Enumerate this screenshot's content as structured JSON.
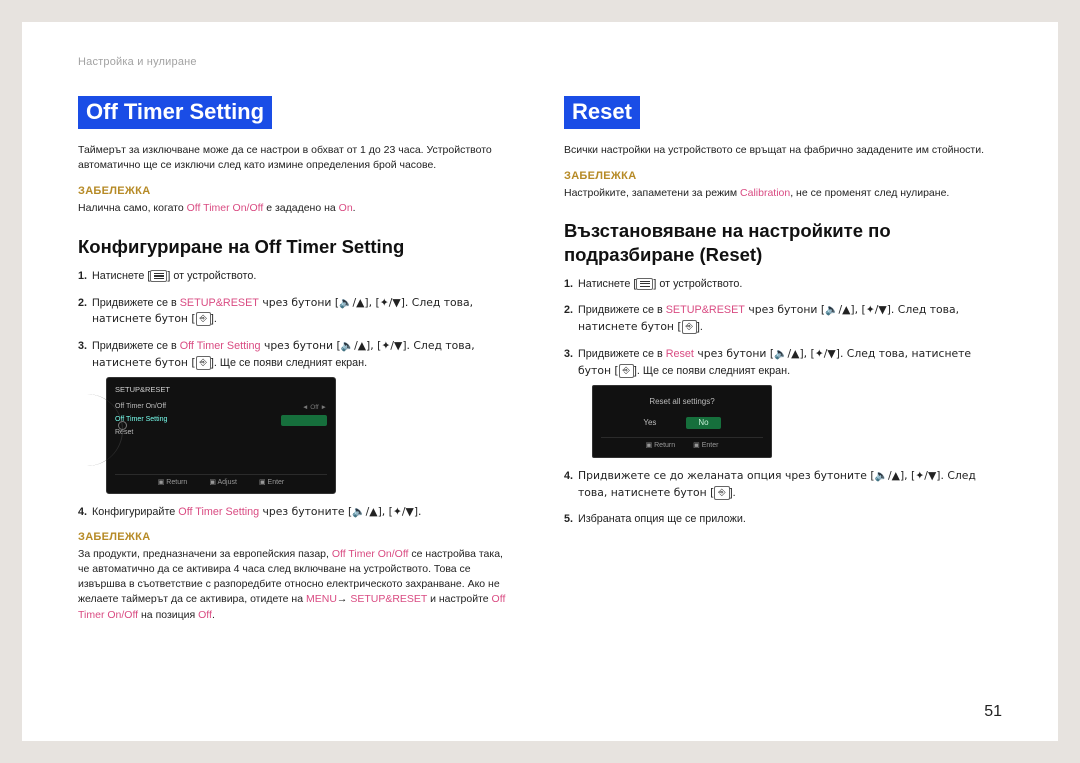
{
  "breadcrumb": "Настройка и нулиране",
  "page_number": "51",
  "icons": {
    "arrow": "→"
  },
  "left": {
    "heading": "Off Timer Setting",
    "intro": "Таймерът за изключване може да се настрои в обхват от 1 до 23 часа. Устройството автоматично ще се изключи след като измине определения брой часове.",
    "note1_label": "ЗАБЕЛЕЖКА",
    "note1_pre": "Налична само, когато ",
    "note1_pink1": "Off Timer On/Off",
    "note1_mid": " е зададено на ",
    "note1_pink2": "On",
    "note1_post": ".",
    "h2": "Конфигуриране на Off Timer Setting",
    "steps": {
      "s1_a": "Натиснете [",
      "s1_b": "] от устройството.",
      "s2_a": "Придвижете се в ",
      "s2_pink": "SETUP&RESET",
      "s2_b": " чрез бутони [🔈/▲], [✦/▼]. След това, натиснете бутон [",
      "s2_c": "].",
      "s3_a": "Придвижете се в ",
      "s3_pink": "Off Timer Setting",
      "s3_b": " чрез бутони [🔈/▲], [✦/▼]. След това, натиснете бутон [",
      "s3_c": "]. Ще се появи следният екран.",
      "s4_a": "Конфигурирайте ",
      "s4_pink": "Off Timer Setting",
      "s4_b": " чрез бутоните [🔈/▲], [✦/▼]."
    },
    "osd": {
      "title": "SETUP&RESET",
      "items": [
        {
          "label": "Off Timer On/Off",
          "value": "Off"
        },
        {
          "label": "Off Timer Setting",
          "selected": true,
          "value": ""
        },
        {
          "label": "Reset",
          "value": ""
        }
      ],
      "btns": [
        "Return",
        "Adjust",
        "Enter"
      ]
    },
    "note2_label": "ЗАБЕЛЕЖКА",
    "note2_a": "За продукти, предназначени за европейския пазар, ",
    "note2_pink1": "Off Timer On/Off",
    "note2_b": " се настройва така, че автоматично да се активира 4 часа след включване на устройството. Това се извършва в съответствие с разпоредбите относно електрическото захранване. Ако не желаете таймерът да се активира, отидете на ",
    "note2_pink2": "MENU",
    "note2_c": " ",
    "note2_pink3": "SETUP&RESET",
    "note2_d": " и настройте ",
    "note2_pink4": "Off Timer On/Off",
    "note2_e": " на позиция ",
    "note2_pink5": "Off",
    "note2_f": "."
  },
  "right": {
    "heading": "Reset",
    "intro": "Всички настройки на устройството се връщат на фабрично зададените им стойности.",
    "note1_label": "ЗАБЕЛЕЖКА",
    "note1_a": "Настройките, запаметени за режим ",
    "note1_pink": "Calibration",
    "note1_b": ", не се променят след нулиране.",
    "h2": "Възстановяване на настройките по подразбиране (Reset)",
    "steps": {
      "s1_a": "Натиснете [",
      "s1_b": "] от устройството.",
      "s2_a": "Придвижете се в ",
      "s2_pink": "SETUP&RESET",
      "s2_b": " чрез бутони [🔈/▲], [✦/▼]. След това, натиснете бутон [",
      "s2_c": "].",
      "s3_a": "Придвижете се в ",
      "s3_pink": "Reset",
      "s3_b": " чрез бутони [🔈/▲], [✦/▼]. След това, натиснете бутон [",
      "s3_c": "]. Ще се появи следният екран.",
      "s4_a": "Придвижете се до желаната опция чрез бутоните [🔈/▲], [✦/▼]. След това, натиснете бутон [",
      "s4_b": "].",
      "s5": "Избраната опция ще се приложи."
    },
    "osd": {
      "question": "Reset all settings?",
      "yes": "Yes",
      "no": "No",
      "btns": [
        "Return",
        "Enter"
      ]
    }
  }
}
